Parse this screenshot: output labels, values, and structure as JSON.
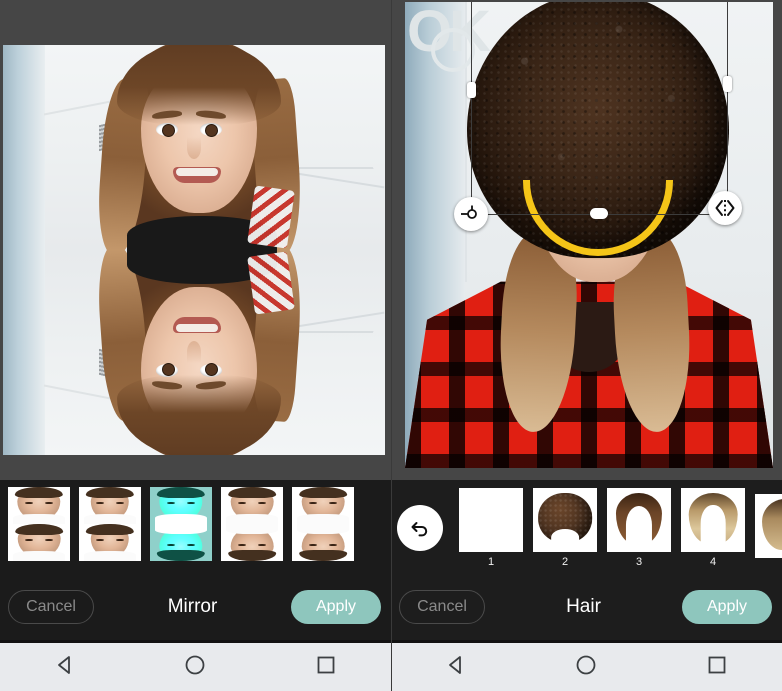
{
  "app": {
    "watermark": "OK",
    "accent_teal": "#8ec6bd",
    "panel_bg": "#1d1d1d",
    "navbar_bg": "#e8eaed",
    "handle_yellow": "#f5c518"
  },
  "left_editor": {
    "tool_title": "Mirror",
    "cancel_label": "Cancel",
    "apply_label": "Apply",
    "thumbnails": [
      {
        "id": "mirror-1",
        "selected": false,
        "label": ""
      },
      {
        "id": "mirror-2",
        "selected": false,
        "label": ""
      },
      {
        "id": "mirror-3",
        "selected": true,
        "label": ""
      },
      {
        "id": "mirror-4",
        "selected": false,
        "label": ""
      },
      {
        "id": "mirror-5",
        "selected": false,
        "label": ""
      }
    ]
  },
  "right_editor": {
    "tool_title": "Hair",
    "cancel_label": "Cancel",
    "apply_label": "Apply",
    "undo_icon": "undo-arrow-icon",
    "thumbnails": [
      {
        "id": "hair-1",
        "label": "1",
        "selected": false
      },
      {
        "id": "hair-2",
        "label": "2",
        "selected": true
      },
      {
        "id": "hair-3",
        "label": "3",
        "selected": false
      },
      {
        "id": "hair-4",
        "label": "4",
        "selected": false
      },
      {
        "id": "hair-5",
        "label": "",
        "selected": false
      }
    ],
    "handles": [
      {
        "id": "rotate-handle",
        "icon": "rotate-pivot-icon"
      },
      {
        "id": "flip-handle",
        "icon": "horizontal-flip-icon"
      }
    ]
  },
  "navbar": {
    "back_label": "Back",
    "home_label": "Home",
    "recents_label": "Recents"
  }
}
